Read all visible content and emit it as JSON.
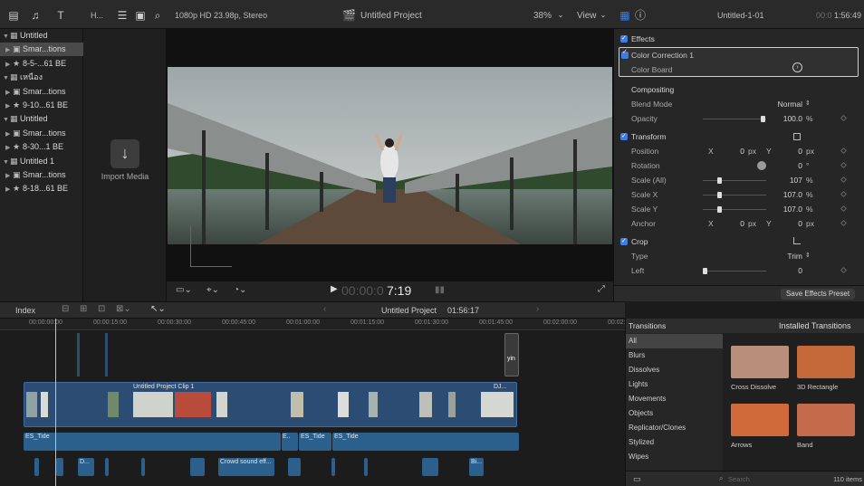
{
  "topbar": {
    "toolbar_label": "H...",
    "viewer_format": "1080p HD 23.98p, Stereo",
    "project_title": "Untitled Project",
    "zoom": "38%",
    "view_menu": "View",
    "inspector_clip_name": "Untitled-1-01",
    "inspector_duration_prefix": "00:0",
    "inspector_duration": "1:56:49"
  },
  "libraries": [
    {
      "label": "Untitled",
      "level": 0,
      "selected": false
    },
    {
      "label": "Smar...tions",
      "level": 1,
      "selected": true
    },
    {
      "label": "8-5-...61 BE",
      "level": 1,
      "selected": false
    },
    {
      "label": "เหนือง",
      "level": 0,
      "selected": false
    },
    {
      "label": "Smar...tions",
      "level": 1,
      "selected": false
    },
    {
      "label": "9-10...61 BE",
      "level": 1,
      "selected": false
    },
    {
      "label": "Untitled",
      "level": 0,
      "selected": false
    },
    {
      "label": "Smar...tions",
      "level": 1,
      "selected": false
    },
    {
      "label": "8-30...1 BE",
      "level": 1,
      "selected": false
    },
    {
      "label": "Untitled 1",
      "level": 0,
      "selected": false
    },
    {
      "label": "Smar...tions",
      "level": 1,
      "selected": false
    },
    {
      "label": "8-18...61 BE",
      "level": 1,
      "selected": false
    }
  ],
  "browser": {
    "import_label": "Import Media"
  },
  "viewer": {
    "timecode_dim": "00:00:0",
    "timecode": "7:19"
  },
  "inspector": {
    "effects_header": "Effects",
    "color_correction": "Color Correction 1",
    "color_board": "Color Board",
    "compositing_header": "Compositing",
    "blend_mode_label": "Blend Mode",
    "blend_mode_value": "Normal",
    "opacity_label": "Opacity",
    "opacity_value": "100.0",
    "opacity_unit": "%",
    "transform_header": "Transform",
    "position_label": "Position",
    "x": "X",
    "y": "Y",
    "position_x": "0",
    "position_y": "0",
    "px": "px",
    "rotation_label": "Rotation",
    "rotation_value": "0",
    "rotation_unit": "°",
    "scale_all_label": "Scale (All)",
    "scale_all_value": "107",
    "scale_x_label": "Scale X",
    "scale_x_value": "107.0",
    "scale_y_label": "Scale Y",
    "scale_y_value": "107.0",
    "anchor_label": "Anchor",
    "anchor_x": "0",
    "anchor_y": "0",
    "crop_header": "Crop",
    "crop_type_label": "Type",
    "crop_type_value": "Trim",
    "left_label": "Left",
    "left_value": "0",
    "save_preset": "Save Effects Preset"
  },
  "timeline_bar": {
    "index_label": "Index",
    "project_name": "Untitled Project",
    "duration": "01:56:17"
  },
  "ruler_ticks": [
    "00:00:00:00",
    "00:00:15:00",
    "00:00:30:00",
    "00:00:45:00",
    "00:01:00:00",
    "00:01:15:00",
    "00:01:30:00",
    "00:01:45:00",
    "00:02:00:00",
    "00:02:15:00"
  ],
  "clips": {
    "main_label": "Untitled Project Clip 1",
    "audio_label_1": "ES_Tide",
    "audio_label_2": "ES_Tide",
    "audio_label_3": "ES_Tide",
    "sfx_label": "Crowd sound eff...",
    "d_label": "D...",
    "bi_label": "Bi...",
    "dj_label": "DJ...",
    "e_label": "E..",
    "title_glyph": "yin"
  },
  "transitions": {
    "header": "Transitions",
    "installed": "Installed Transitions",
    "categories": [
      "All",
      "Blurs",
      "Dissolves",
      "Lights",
      "Movements",
      "Objects",
      "Replicator/Clones",
      "Stylized",
      "Wipes"
    ],
    "selected_category": "All",
    "items": [
      {
        "name": "Cross Dissolve",
        "color": "#b98e7a"
      },
      {
        "name": "3D Rectangle",
        "color": "#c5683a"
      },
      {
        "name": "Arrows",
        "color": "#d06a3a"
      },
      {
        "name": "Band",
        "color": "#c46b4c"
      }
    ],
    "search_placeholder": "Search",
    "item_count": "110 items"
  },
  "colors": {
    "accent": "#3d7ee6",
    "playhead": "#f1c232",
    "clip_video": "#2d4c74",
    "clip_audio": "#2b5f8c"
  }
}
